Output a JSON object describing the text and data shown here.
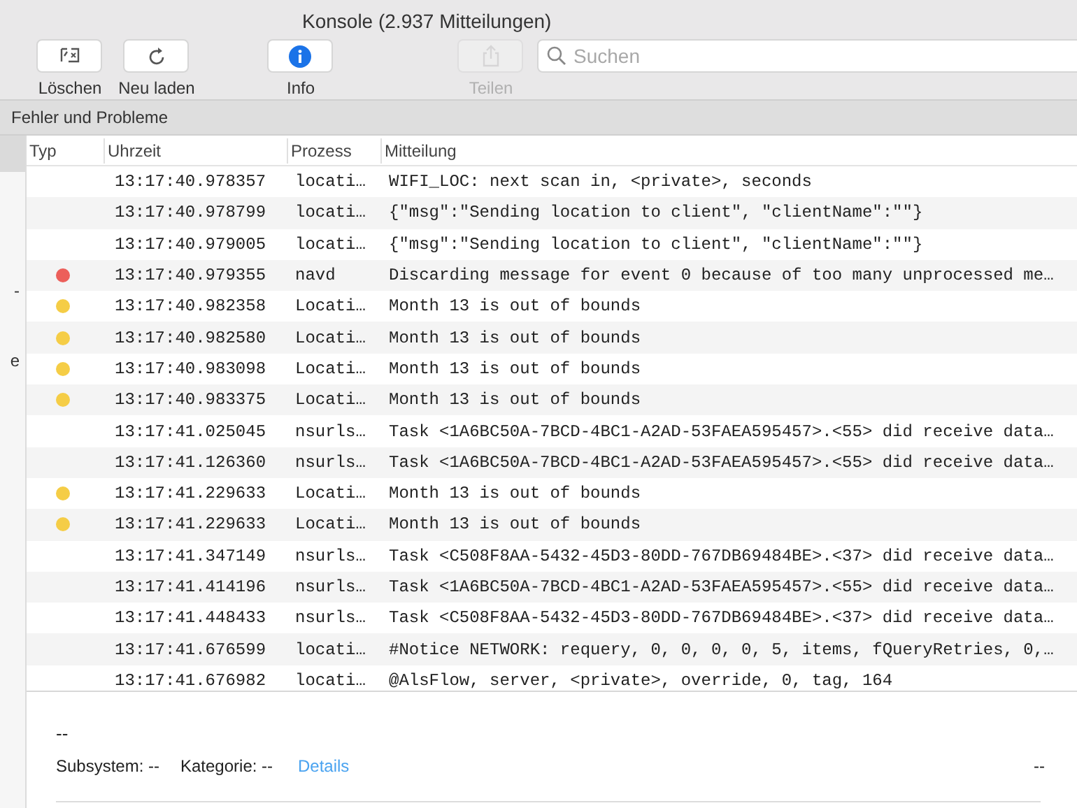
{
  "window": {
    "title": "Konsole (2.937 Mitteilungen)"
  },
  "toolbar": {
    "buttons": [
      {
        "kind": "clear",
        "label": "Löschen",
        "disabled": false
      },
      {
        "kind": "reload",
        "label": "Neu laden",
        "disabled": false
      },
      {
        "kind": "info",
        "label": "Info",
        "disabled": false
      },
      {
        "kind": "share",
        "label": "Teilen",
        "disabled": true
      }
    ],
    "search": {
      "placeholder": "Suchen"
    }
  },
  "filter_bar": {
    "label": "Fehler und Probleme"
  },
  "sidebar": {
    "items": [
      {
        "selected": true
      },
      {
        "label": "-",
        "selected": false
      },
      {
        "label": "e",
        "selected": false
      }
    ]
  },
  "table": {
    "columns": [
      "Typ",
      "Uhrzeit",
      "Prozess",
      "Mitteilung"
    ],
    "rows": [
      {
        "time": "13:17:40.978357",
        "process": "locati…",
        "message": "WIFI_LOC: next scan in, <private>, seconds"
      },
      {
        "time": "13:17:40.978799",
        "process": "locati…",
        "message": "{\"msg\":\"Sending location to client\", \"clientName\":\"\"}"
      },
      {
        "time": "13:17:40.979005",
        "process": "locati…",
        "message": "{\"msg\":\"Sending location to client\", \"clientName\":\"\"}"
      },
      {
        "color": "#ec5f5a",
        "time": "13:17:40.979355",
        "process": "navd",
        "message": "Discarding message for event 0 because of too many unprocessed me…"
      },
      {
        "color": "#f5cd46",
        "time": "13:17:40.982358",
        "process": "Locati…",
        "message": "Month 13 is out of bounds"
      },
      {
        "color": "#f5cd46",
        "time": "13:17:40.982580",
        "process": "Locati…",
        "message": "Month 13 is out of bounds"
      },
      {
        "color": "#f5cd46",
        "time": "13:17:40.983098",
        "process": "Locati…",
        "message": "Month 13 is out of bounds"
      },
      {
        "color": "#f5cd46",
        "time": "13:17:40.983375",
        "process": "Locati…",
        "message": "Month 13 is out of bounds"
      },
      {
        "time": "13:17:41.025045",
        "process": "nsurls…",
        "message": "Task <1A6BC50A-7BCD-4BC1-A2AD-53FAEA595457>.<55> did receive data…"
      },
      {
        "time": "13:17:41.126360",
        "process": "nsurls…",
        "message": "Task <1A6BC50A-7BCD-4BC1-A2AD-53FAEA595457>.<55> did receive data…"
      },
      {
        "color": "#f5cd46",
        "time": "13:17:41.229633",
        "process": "Locati…",
        "message": "Month 13 is out of bounds"
      },
      {
        "color": "#f5cd46",
        "time": "13:17:41.229633",
        "process": "Locati…",
        "message": "Month 13 is out of bounds"
      },
      {
        "time": "13:17:41.347149",
        "process": "nsurls…",
        "message": "Task <C508F8AA-5432-45D3-80DD-767DB69484BE>.<37> did receive data…"
      },
      {
        "time": "13:17:41.414196",
        "process": "nsurls…",
        "message": "Task <1A6BC50A-7BCD-4BC1-A2AD-53FAEA595457>.<55> did receive data…"
      },
      {
        "time": "13:17:41.448433",
        "process": "nsurls…",
        "message": "Task <C508F8AA-5432-45D3-80DD-767DB69484BE>.<37> did receive data…"
      },
      {
        "time": "13:17:41.676599",
        "process": "locati…",
        "message": "#Notice NETWORK: requery, 0, 0, 0, 0, 5, items, fQueryRetries, 0,…"
      },
      {
        "time": "13:17:41.676982",
        "process": "locati…",
        "message": "@AlsFlow, server, <private>, override, 0, tag, 164"
      }
    ]
  },
  "details": {
    "message": "--",
    "subsystem_label": "Subsystem: --",
    "category_label": "Kategorie: --",
    "link": "Details",
    "right_value": "--"
  }
}
